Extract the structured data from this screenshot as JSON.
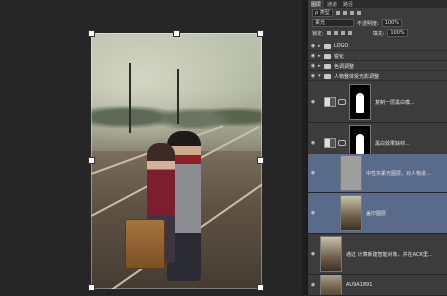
{
  "panel": {
    "tabs": [
      "图层",
      "通道",
      "路径"
    ],
    "filter_label": "ρ 类型",
    "blend_mode": "柔光",
    "opacity_label": "不透明度:",
    "opacity_value": "100%",
    "lock_label": "锁定:",
    "fill_label": "填充:",
    "fill_value": "100%"
  },
  "layers": {
    "groups": [
      {
        "name": "LOGO"
      },
      {
        "name": "锐化"
      },
      {
        "name": "色调调整"
      },
      {
        "name": "人物整体受光影调整"
      }
    ],
    "items": [
      {
        "name": "复制一层黑白模..."
      },
      {
        "name": "黑白效果缺材..."
      },
      {
        "name": "中性灰柔光图层，对人物进..."
      },
      {
        "name": "盖印图层"
      },
      {
        "name": "通过 计算新建智能对象，并在ACR里..."
      },
      {
        "name": "AU9A1891"
      }
    ]
  },
  "colors": {
    "panel_bg": "#3c3c3c",
    "selection": "#5a6a8a",
    "canvas_bg": "#262626"
  }
}
